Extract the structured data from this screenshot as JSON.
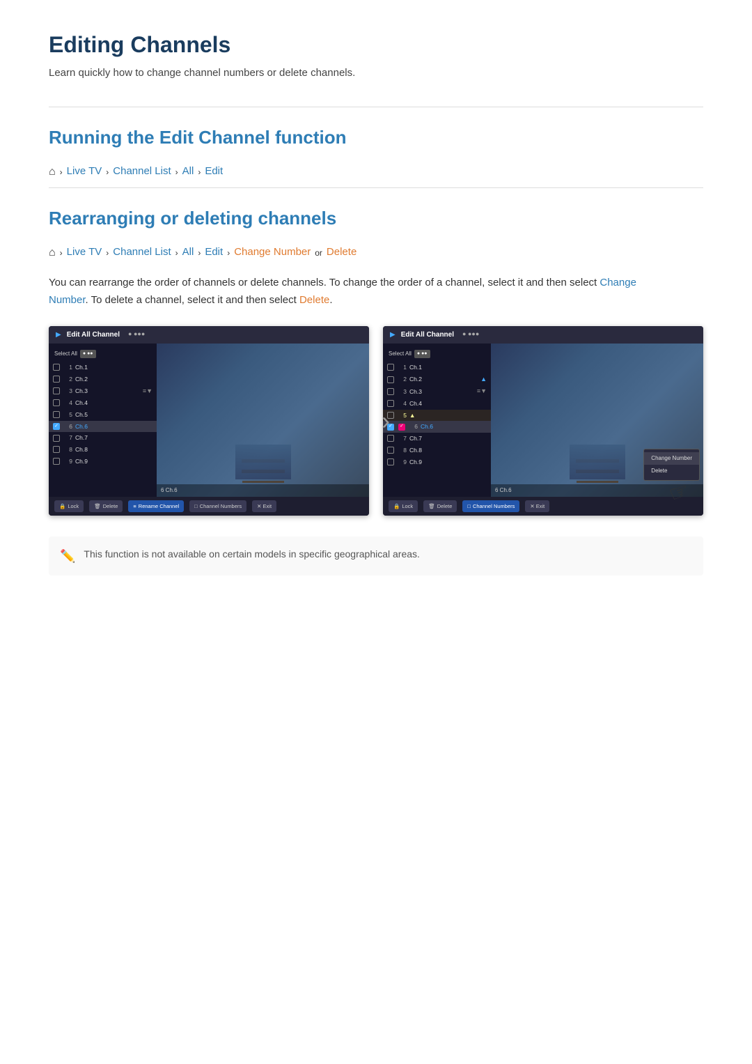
{
  "page": {
    "title": "Editing Channels",
    "subtitle": "Learn quickly how to change channel numbers or delete channels.",
    "sections": [
      {
        "id": "edit-channel-function",
        "title": "Running the Edit Channel function",
        "breadcrumb": {
          "items": [
            "Live TV",
            "Channel List",
            "All",
            "Edit"
          ],
          "highlight_last": "blue"
        }
      },
      {
        "id": "rearranging-deleting",
        "title": "Rearranging or deleting channels",
        "breadcrumb": {
          "items": [
            "Live TV",
            "Channel List",
            "All",
            "Edit",
            "Change Number",
            "Delete"
          ],
          "highlight_last_two": true
        },
        "body": "You can rearrange the order of channels or delete channels. To change the order of a channel, select it and then select Change Number. To delete a channel, select it and then select Delete.",
        "change_number_label": "Change Number",
        "delete_label": "Delete"
      }
    ],
    "note": "This function is not available on certain models in specific geographical areas.",
    "screenshot": {
      "header_title": "Edit All Channel",
      "select_all": "Select All",
      "channels": [
        {
          "num": "1",
          "name": "Ch.1",
          "checked": false
        },
        {
          "num": "2",
          "name": "Ch.2",
          "checked": false
        },
        {
          "num": "3",
          "name": "Ch.3",
          "checked": false
        },
        {
          "num": "4",
          "name": "Ch.4",
          "checked": false
        },
        {
          "num": "5",
          "name": "Ch.5",
          "checked": false
        },
        {
          "num": "6",
          "name": "Ch.6",
          "checked": true
        },
        {
          "num": "7",
          "name": "Ch.7",
          "checked": false
        },
        {
          "num": "8",
          "name": "Ch.8",
          "checked": false
        },
        {
          "num": "9",
          "name": "Ch.9",
          "checked": false
        }
      ],
      "footer_buttons": [
        "Lock",
        "Delete",
        "Rename Channel",
        "Channel Numbers",
        "Exit"
      ]
    }
  }
}
